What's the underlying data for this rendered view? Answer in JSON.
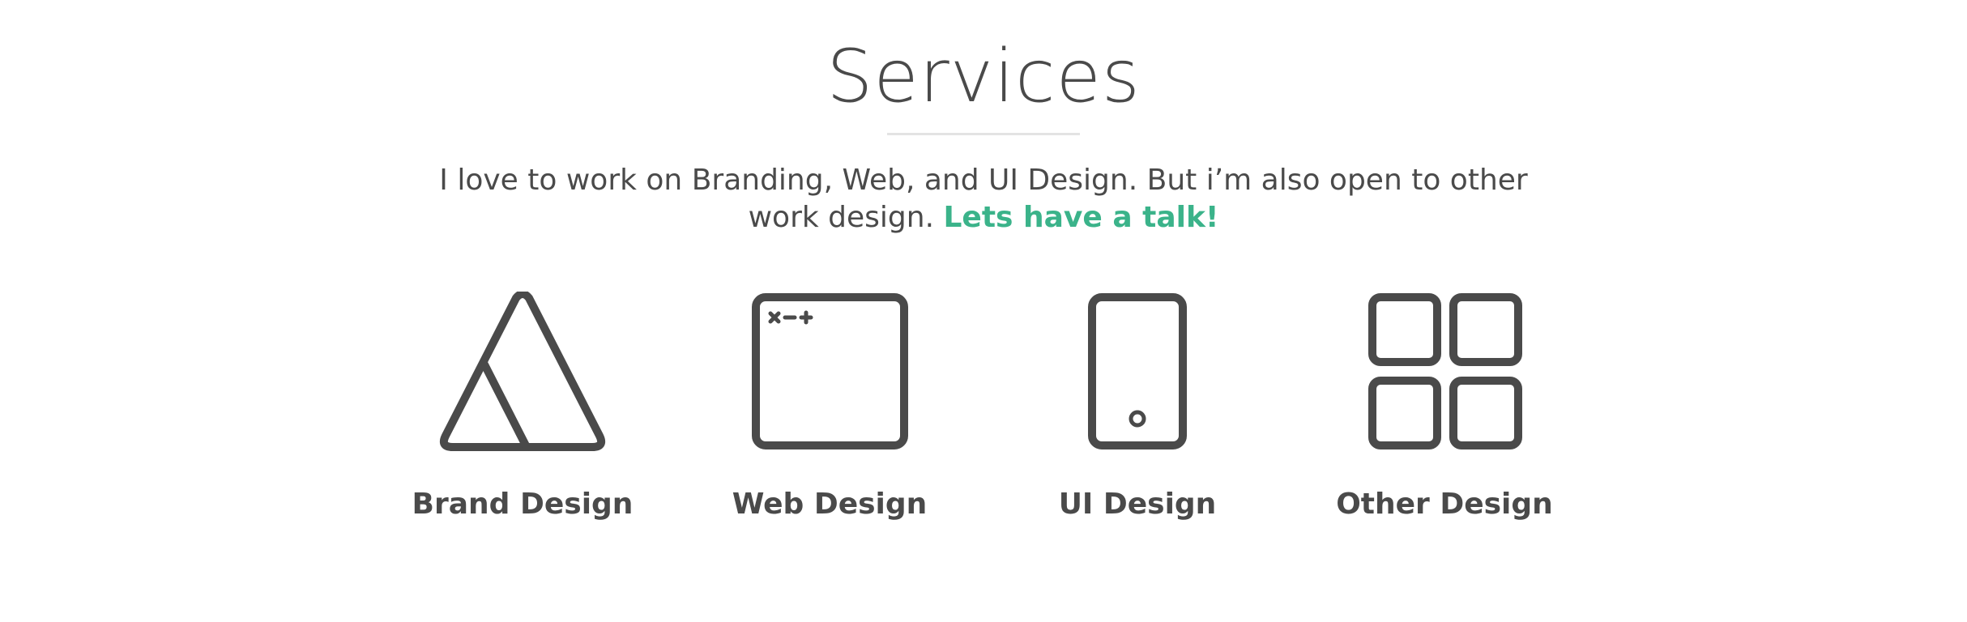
{
  "section": {
    "title": "Services",
    "intro_text": "I love to work on Branding, Web, and UI Design. But i’m also open to other work design. ",
    "intro_cta": "Lets have a talk!",
    "accent_color": "#3bb38a",
    "text_color": "#4a4a4a"
  },
  "services": [
    {
      "label": "Brand Design",
      "icon": "triangle-logo-icon"
    },
    {
      "label": "Web Design",
      "icon": "browser-window-icon"
    },
    {
      "label": "UI Design",
      "icon": "mobile-phone-icon"
    },
    {
      "label": "Other Design",
      "icon": "grid-four-squares-icon"
    }
  ]
}
